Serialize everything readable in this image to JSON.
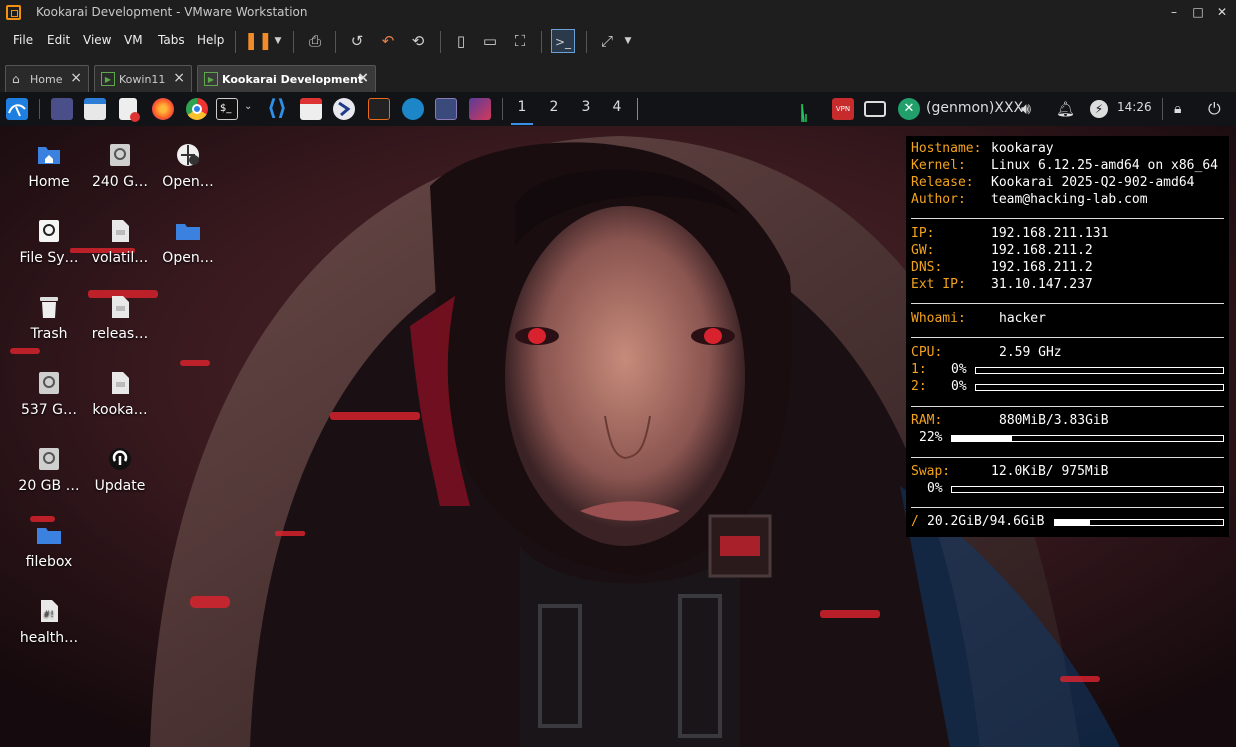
{
  "window": {
    "title": "Kookarai Development - VMware Workstation",
    "controls": [
      "–",
      "□",
      "✕"
    ]
  },
  "menu": {
    "items": [
      "File",
      "Edit",
      "View",
      "VM",
      "Tabs",
      "Help"
    ]
  },
  "tabs": [
    {
      "label": "Home",
      "icon": "home-icon",
      "active": false
    },
    {
      "label": "Kowin11",
      "icon": "vm-icon",
      "active": false
    },
    {
      "label": "Kookarai Development",
      "icon": "vm-icon",
      "active": true
    }
  ],
  "panel": {
    "workspaces": [
      "1",
      "2",
      "3",
      "4"
    ],
    "user": "(genmon)XXX",
    "clock": "14:26"
  },
  "desktop_icons": [
    {
      "label": "Home",
      "icon": "home-folder-icon"
    },
    {
      "label": "240 G…",
      "icon": "drive-icon"
    },
    {
      "label": "Open…",
      "icon": "network-icon"
    },
    {
      "label": "File Sy…",
      "icon": "drive-icon"
    },
    {
      "label": "volatil…",
      "icon": "text-file-icon"
    },
    {
      "label": "Open…",
      "icon": "folder-icon"
    },
    {
      "label": "Trash",
      "icon": "trash-icon"
    },
    {
      "label": "releas…",
      "icon": "text-file-icon"
    },
    {
      "label": "537 G…",
      "icon": "drive-icon"
    },
    {
      "label": "kooka…",
      "icon": "text-file-icon"
    },
    {
      "label": "20 GB …",
      "icon": "drive-icon"
    },
    {
      "label": "Update",
      "icon": "update-icon"
    },
    {
      "label": "filebox",
      "icon": "folder-icon"
    },
    {
      "label": "health…",
      "icon": "script-file-icon"
    }
  ],
  "conky": {
    "hostname_k": "Hostname:",
    "hostname_v": "kookaray",
    "kernel_k": "Kernel:",
    "kernel_v": "Linux 6.12.25-amd64 on x86_64",
    "release_k": "Release:",
    "release_v": "Kookarai 2025-Q2-902-amd64",
    "author_k": "Author:",
    "author_v": "team@hacking-lab.com",
    "ip_k": "IP:",
    "ip_v": "192.168.211.131",
    "gw_k": "GW:",
    "gw_v": "192.168.211.2",
    "dns_k": "DNS:",
    "dns_v": "192.168.211.2",
    "extip_k": "Ext IP:",
    "extip_v": "31.10.147.237",
    "whoami_k": "Whoami:",
    "whoami_v": "hacker",
    "cpu_k": "CPU:",
    "cpu_v": "2.59 GHz",
    "cpu1_k": "1:",
    "cpu1_v": "0%",
    "cpu1_frac": 0,
    "cpu2_k": "2:",
    "cpu2_v": "0%",
    "cpu2_frac": 0,
    "ram_k": "RAM:",
    "ram_v": "880MiB/3.83GiB",
    "ram_pct": "22%",
    "ram_frac": 0.22,
    "swap_k": "Swap:",
    "swap_v": "12.0KiB/ 975MiB",
    "swap_pct": "0%",
    "swap_frac": 0,
    "disk_k": "/",
    "disk_v": "20.2GiB/94.6GiB",
    "disk_frac": 0.21
  },
  "colors": {
    "conky_key": "#f3a21d",
    "chrome_bg": "#1e1e1e",
    "panel_bg": "#121317"
  }
}
